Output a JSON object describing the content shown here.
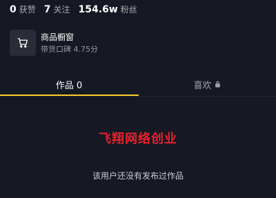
{
  "stats": [
    {
      "value": "0",
      "label": "获赞"
    },
    {
      "value": "7",
      "label": "关注"
    },
    {
      "value": "154.6w",
      "label": "粉丝"
    }
  ],
  "showcase": {
    "icon": "cart-icon",
    "title": "商品橱窗",
    "subtitle": "带货口碑 4.75分"
  },
  "tabs": {
    "works_label": "作品 0",
    "likes_label": "喜欢",
    "likes_icon": "lock-icon"
  },
  "watermark": "飞翔网络创业",
  "empty_message": "该用户还没有发布过作品",
  "colors": {
    "background": "#161823",
    "accent_underline": "#facd2c",
    "watermark": "#e8212d"
  }
}
